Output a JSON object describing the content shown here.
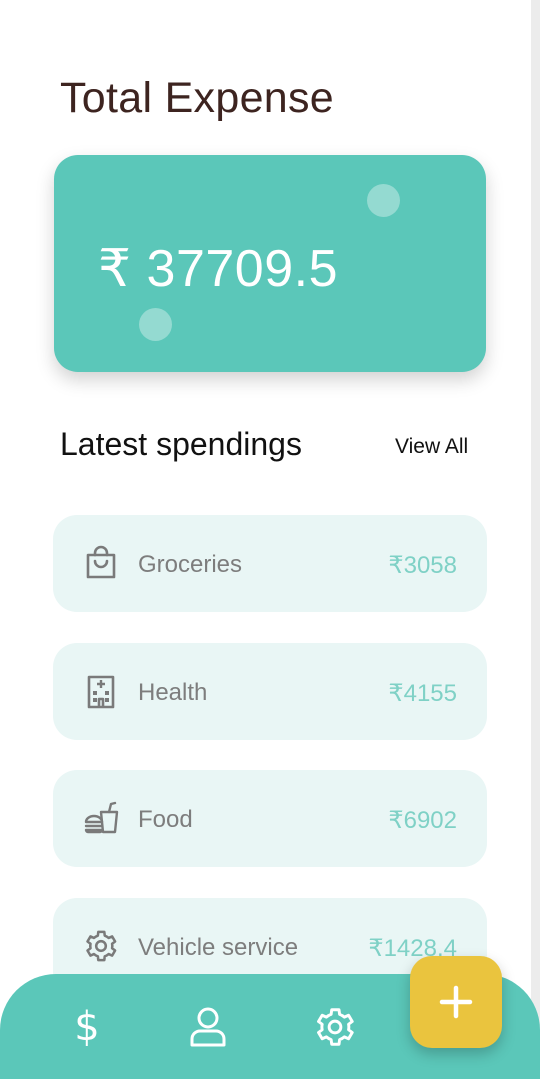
{
  "header": {
    "title": "Total Expense"
  },
  "total_card": {
    "amount": "₹ 37709.5"
  },
  "latest": {
    "title": "Latest spendings",
    "view_all": "View All"
  },
  "spendings": [
    {
      "label": "Groceries",
      "amount": "₹3058",
      "icon": "shopping-bag-icon"
    },
    {
      "label": "Health",
      "amount": "₹4155",
      "icon": "hospital-building-icon"
    },
    {
      "label": "Food",
      "amount": "₹6902",
      "icon": "fast-food-icon"
    },
    {
      "label": "Vehicle service",
      "amount": "₹1428.4",
      "icon": "gear-icon"
    }
  ],
  "nav": {
    "dollar_glyph": "$",
    "items": [
      "dollar-icon",
      "user-icon",
      "settings-icon"
    ],
    "fab_icon": "plus-icon"
  },
  "colors": {
    "accent": "#5bc7b9",
    "card_bg": "#e9f6f5",
    "amount_text": "#7fd1c6",
    "fab": "#eac43e",
    "title_text": "#3d2420"
  }
}
